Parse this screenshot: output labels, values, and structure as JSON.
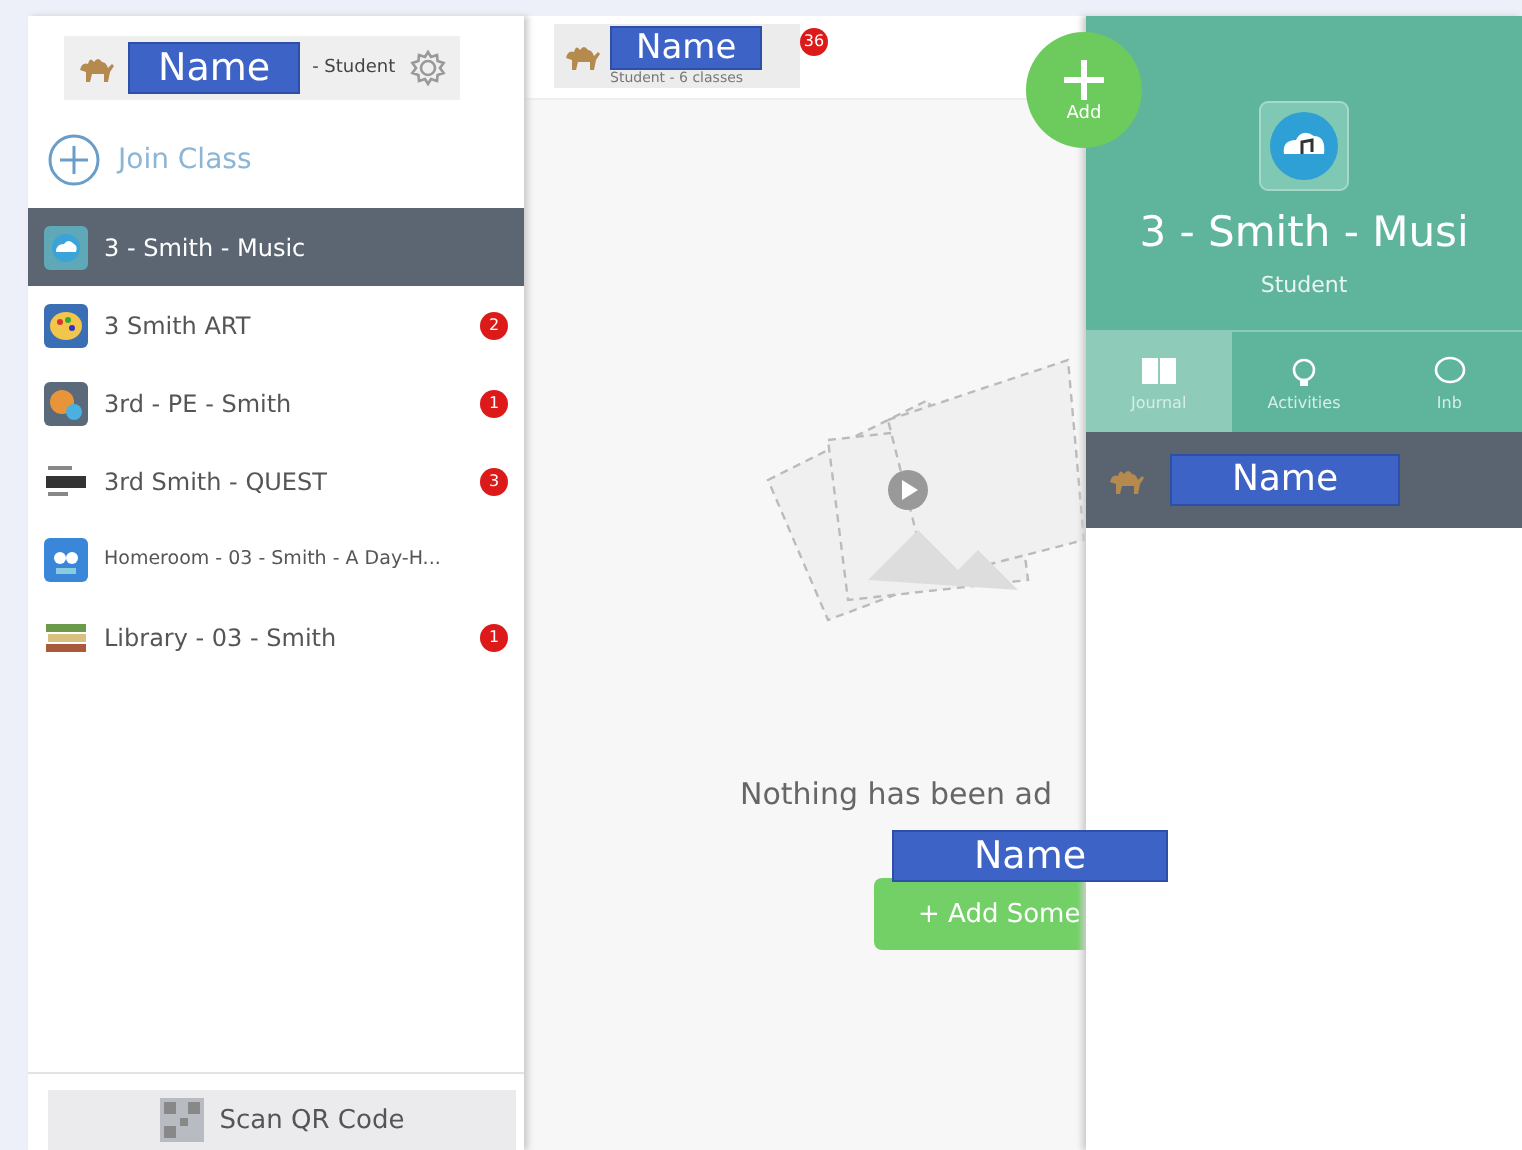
{
  "sidebar": {
    "user": {
      "name": "Name",
      "role": "- Student"
    },
    "join_class": "Join Class",
    "classes": [
      {
        "kind": "cloud",
        "name": "3 - Smith - Music",
        "selected": true
      },
      {
        "kind": "palette",
        "name": "3 Smith ART",
        "badge": "2",
        "selected": false
      },
      {
        "kind": "sports",
        "name": "3rd - PE - Smith",
        "badge": "1",
        "selected": false
      },
      {
        "kind": "quest",
        "name": "3rd Smith - QUEST",
        "badge": "3",
        "selected": false
      },
      {
        "kind": "owl",
        "name": "Homeroom - 03 - Smith - A Day-H...",
        "selected": false
      },
      {
        "kind": "books",
        "name": "Library - 03 - Smith",
        "badge": "1",
        "selected": false
      }
    ],
    "scan_button": "Scan QR Code"
  },
  "main": {
    "header": {
      "name": "Name",
      "subtitle": "Student - 6 classes",
      "badge": "36"
    },
    "add_button": "Add",
    "empty_message": "Nothing has been ad",
    "overlay_name": "Name",
    "add_some_button": "+ Add Some"
  },
  "class_panel": {
    "title": "3 - Smith - Musi",
    "role": "Student",
    "tabs": [
      {
        "kind": "journal",
        "label": "Journal",
        "selected": true
      },
      {
        "kind": "activities",
        "label": "Activities",
        "selected": false
      },
      {
        "kind": "inbox",
        "label": "Inb",
        "selected": false
      }
    ],
    "user_bar": {
      "name": "Name"
    }
  }
}
